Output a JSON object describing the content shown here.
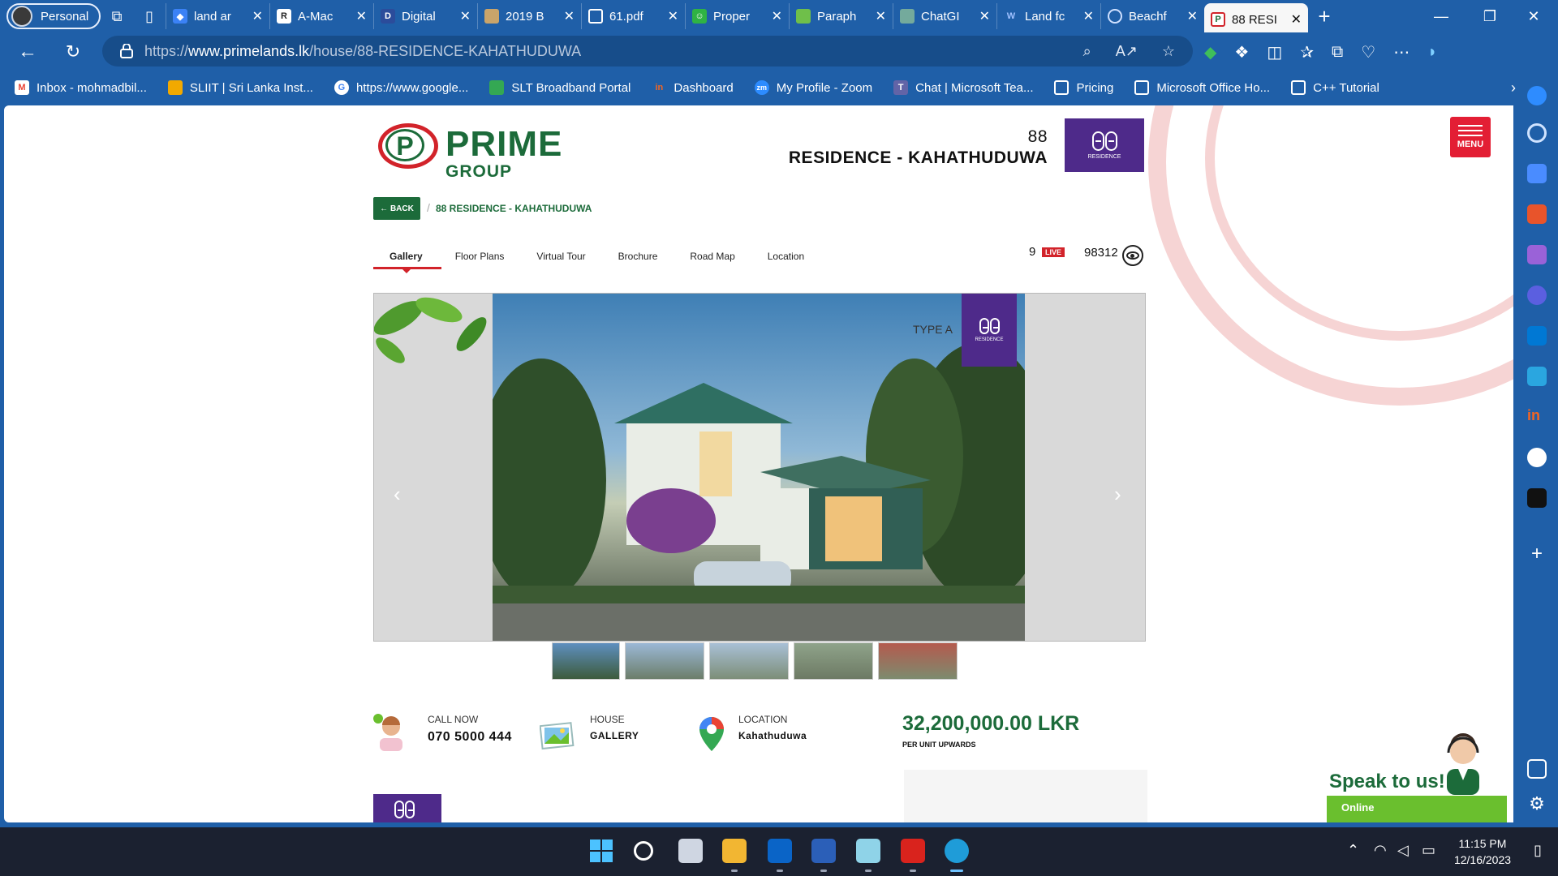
{
  "browser": {
    "profile_label": "Personal",
    "tabs": [
      {
        "title": "land ar",
        "icon": "cloud-icon"
      },
      {
        "title": "A-Mac",
        "icon": "r-logo-icon"
      },
      {
        "title": "Digital",
        "icon": "d-logo-icon"
      },
      {
        "title": "2019 B",
        "icon": "image-icon"
      },
      {
        "title": "61.pdf",
        "icon": "document-icon"
      },
      {
        "title": "Proper",
        "icon": "smiley-icon"
      },
      {
        "title": "Paraph",
        "icon": "android-icon"
      },
      {
        "title": "ChatGI",
        "icon": "chatgpt-icon"
      },
      {
        "title": "Land fc",
        "icon": "wix-icon"
      },
      {
        "title": "Beachf",
        "icon": "loading-icon"
      },
      {
        "title": "88 RESI",
        "icon": "prime-icon",
        "active": true
      }
    ],
    "url_prefix": "https://",
    "url_domain": "www.primelands.lk",
    "url_path": "/house/88-RESIDENCE-KAHATHUDUWA",
    "bookmarks": [
      {
        "label": "Inbox - mohmadbil...",
        "icon": "gmail-icon",
        "color": "#ea4335"
      },
      {
        "label": "SLIIT | Sri Lanka Inst...",
        "icon": "sliit-icon",
        "color": "#f2a900"
      },
      {
        "label": "https://www.google...",
        "icon": "google-icon",
        "color": "#4285f4"
      },
      {
        "label": "SLT Broadband Portal",
        "icon": "slt-icon",
        "color": "#34a853"
      },
      {
        "label": "Dashboard",
        "icon": "in-icon",
        "color": "#f26522"
      },
      {
        "label": "My Profile - Zoom",
        "icon": "zoom-icon",
        "color": "#2d8cff"
      },
      {
        "label": "Chat | Microsoft Tea...",
        "icon": "teams-icon",
        "color": "#6264a7"
      },
      {
        "label": "Pricing",
        "icon": "page-icon",
        "color": "#ffffff"
      },
      {
        "label": "Microsoft Office Ho...",
        "icon": "page-icon",
        "color": "#ffffff"
      },
      {
        "label": "C++ Tutorial",
        "icon": "page-icon",
        "color": "#ffffff"
      }
    ]
  },
  "site": {
    "logo_prime": "PRIME",
    "logo_group": "GROUP",
    "logo_letter": "P",
    "project_title_line1": "88",
    "project_title_line2": "RESIDENCE - KAHATHUDUWA",
    "menu_label": "MENU",
    "back_label": "BACK",
    "breadcrumb": "88 RESIDENCE - KAHATHUDUWA",
    "tabs": [
      "Gallery",
      "Floor Plans",
      "Virtual Tour",
      "Brochure",
      "Road Map",
      "Location"
    ],
    "live_count": "9",
    "live_label": "LIVE",
    "view_count": "98312",
    "slide_type": "TYPE A",
    "badge_text": "RESIDENCE",
    "info": {
      "call_label": "CALL NOW",
      "call_value": "070 5000 444",
      "house_label": "HOUSE",
      "house_value": "GALLERY",
      "location_label": "LOCATION",
      "location_value": "Kahathuduwa"
    },
    "price": "32,200,000.00 LKR",
    "price_sub": "PER UNIT UPWARDS",
    "chat_title": "Speak to us!",
    "chat_status": "Online"
  },
  "colors": {
    "brand_green": "#1c6b3a",
    "brand_red": "#d2232a",
    "badge_purple": "#4e2a8a",
    "edge_blue": "#1f5fa8"
  },
  "taskbar": {
    "time": "11:15 PM",
    "date": "12/16/2023"
  }
}
